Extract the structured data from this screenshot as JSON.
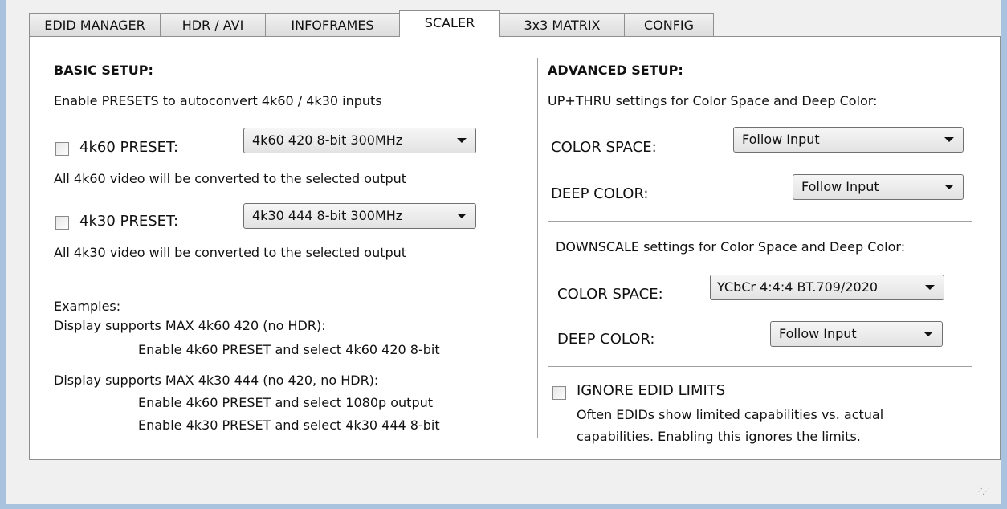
{
  "tabs": [
    {
      "label": "EDID MANAGER"
    },
    {
      "label": "HDR / AVI"
    },
    {
      "label": "INFOFRAMES"
    },
    {
      "label": "SCALER",
      "active": true
    },
    {
      "label": "3x3 MATRIX"
    },
    {
      "label": "CONFIG"
    }
  ],
  "basic": {
    "heading": "BASIC SETUP:",
    "intro": "Enable PRESETS to autoconvert 4k60 / 4k30 inputs",
    "preset4k60": {
      "label": "4k60 PRESET:",
      "selected": "4k60 420 8-bit 300MHz",
      "note": "All 4k60 video will be converted to the selected output",
      "checked": false
    },
    "preset4k30": {
      "label": "4k30 PRESET:",
      "selected": "4k30 444 8-bit 300MHz",
      "note": "All 4k30 video will be converted to the selected output",
      "checked": false
    },
    "examples": {
      "title": "Examples:",
      "ex1_head": "Display supports MAX 4k60 420 (no HDR):",
      "ex1_line1": "Enable 4k60 PRESET and select 4k60 420 8-bit",
      "ex2_head": "Display supports MAX 4k30 444 (no 420, no HDR):",
      "ex2_line1": "Enable 4k60 PRESET and select 1080p output",
      "ex2_line2": "Enable 4k30 PRESET and select 4k30 444 8-bit"
    }
  },
  "advanced": {
    "heading": "ADVANCED SETUP:",
    "upthru": {
      "caption": "UP+THRU settings for Color Space and Deep Color:",
      "color_space_label": "COLOR SPACE:",
      "color_space_value": "Follow Input",
      "deep_color_label": "DEEP COLOR:",
      "deep_color_value": "Follow Input"
    },
    "downscale": {
      "caption": "DOWNSCALE settings for Color Space and Deep Color:",
      "color_space_label": "COLOR SPACE:",
      "color_space_value": "YCbCr 4:4:4 BT.709/2020",
      "deep_color_label": "DEEP COLOR:",
      "deep_color_value": "Follow Input"
    },
    "ignore_edid": {
      "label": "IGNORE EDID LIMITS",
      "desc1": "Often EDIDs show limited capabilities vs. actual",
      "desc2": "capabilities. Enabling this ignores the limits.",
      "checked": false
    }
  },
  "icons": {
    "resize_grip": "resize-grip-icon",
    "dropdown": "chevron-down-icon"
  }
}
